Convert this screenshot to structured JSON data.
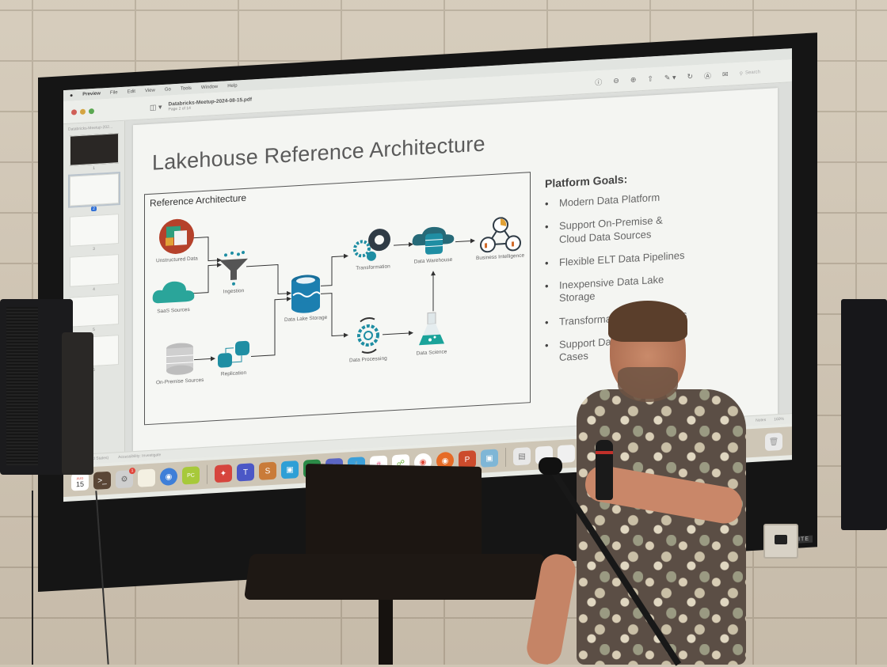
{
  "menubar": {
    "apple": "",
    "app_name": "Preview",
    "items": [
      "File",
      "Edit",
      "View",
      "Go",
      "Tools",
      "Window",
      "Help"
    ]
  },
  "window": {
    "file_name": "Databricks-Meetup-2024-08-15.pdf",
    "page_indicator": "Page 2 of 14",
    "sidebar_title": "Databricks-Meetup-202...",
    "search_placeholder": "Search",
    "toolbar_icons": [
      "info-icon",
      "zoom-out-icon",
      "zoom-in-icon",
      "share-icon",
      "markup-pen-icon",
      "rotate-icon",
      "annotate-icon",
      "form-icon",
      "search-icon"
    ]
  },
  "thumbnails": [
    {
      "num": "1"
    },
    {
      "num": "2",
      "selected": true
    },
    {
      "num": "3"
    },
    {
      "num": "4"
    },
    {
      "num": "5"
    },
    {
      "num": "6"
    }
  ],
  "slide": {
    "title": "Lakehouse Reference Architecture",
    "diagram": {
      "title": "Reference Architecture",
      "nodes": {
        "unstructured": "Unstructured Data",
        "saas": "SaaS Sources",
        "onprem": "On-Premise Sources",
        "ingestion": "Ingestion",
        "replication": "Replication",
        "datalake": "Data Lake Storage",
        "transformation": "Transformation",
        "processing": "Data Processing",
        "warehouse": "Data Warehouse",
        "science": "Data Science",
        "bi": "Business Intelligence"
      }
    },
    "goals": {
      "heading": "Platform Goals:",
      "items": [
        "Modern Data Platform",
        "Support On-Premise & Cloud Data Sources",
        "Flexible ELT Data Pipelines",
        "Inexpensive Data Lake Storage",
        "Transformation on Business",
        "Support Data Science Use Cases"
      ]
    }
  },
  "statusbar": {
    "language": "English (United States)",
    "accessibility": "Accessibility: Investigate",
    "notes": "Notes",
    "zoom": "160%"
  },
  "dock": {
    "calendar_month": "AUG",
    "calendar_day": "15",
    "settings_badge": "1",
    "apps": [
      {
        "name": "calendar",
        "color": "#ffffff"
      },
      {
        "name": "terminal",
        "color": "#5a4636"
      },
      {
        "name": "system-settings",
        "color": "#cfcfcf"
      },
      {
        "name": "notes",
        "color": "#f4f0e2"
      },
      {
        "name": "maps-pin",
        "color": "#3f7fd8"
      },
      {
        "name": "pycharm",
        "color": "#a7c93a"
      },
      {
        "name": "vpn-shield",
        "color": "#d6453d"
      },
      {
        "name": "teams",
        "color": "#4b57c6"
      },
      {
        "name": "sublime",
        "color": "#c97b39"
      },
      {
        "name": "remote-desktop",
        "color": "#2e9fd6"
      },
      {
        "name": "excel",
        "color": "#2b8a47"
      },
      {
        "name": "ai-assistant",
        "color": "#5b66c4"
      },
      {
        "name": "docker",
        "color": "#3b9fd9"
      },
      {
        "name": "slack",
        "color": "#ffffff"
      },
      {
        "name": "git-client",
        "color": "#ffffff"
      },
      {
        "name": "chrome",
        "color": "#ffffff"
      },
      {
        "name": "firefox",
        "color": "#e66b26"
      },
      {
        "name": "powerpoint",
        "color": "#cc4b2c"
      },
      {
        "name": "preview",
        "color": "#7fb6d6"
      }
    ],
    "trash": "trash"
  },
  "projector_brand": "DA-LITE",
  "colors": {
    "teal": "#1f8ea3",
    "dark_gear": "#2f3b45",
    "slide_bg": "#f4f5f2"
  }
}
